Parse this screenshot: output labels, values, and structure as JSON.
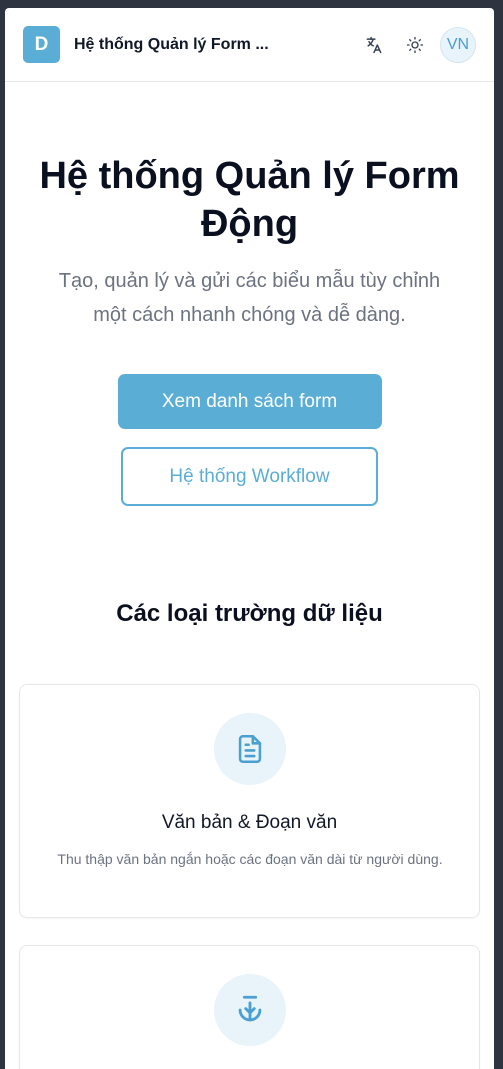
{
  "header": {
    "logo_letter": "D",
    "app_title": "Hệ thống Quản lý Form ...",
    "avatar_text": "VN"
  },
  "hero": {
    "title": "Hệ thống Quản lý Form Động",
    "subtitle": "Tạo, quản lý và gửi các biểu mẫu tùy chỉnh một cách nhanh chóng và dễ dàng.",
    "primary_button": "Xem danh sách form",
    "secondary_button": "Hệ thống Workflow"
  },
  "fields_section": {
    "title": "Các loại trường dữ liệu",
    "cards": [
      {
        "icon": "document-text-icon",
        "title": "Văn bản & Đoạn văn",
        "description": "Thu thập văn bản ngắn hoặc các đoạn văn dài từ người dùng."
      },
      {
        "icon": "anchor-icon"
      }
    ]
  },
  "colors": {
    "accent": "#5aaed6",
    "icon_bg": "#e8f3fa",
    "heading": "#0b1020",
    "muted": "#6b7280"
  }
}
